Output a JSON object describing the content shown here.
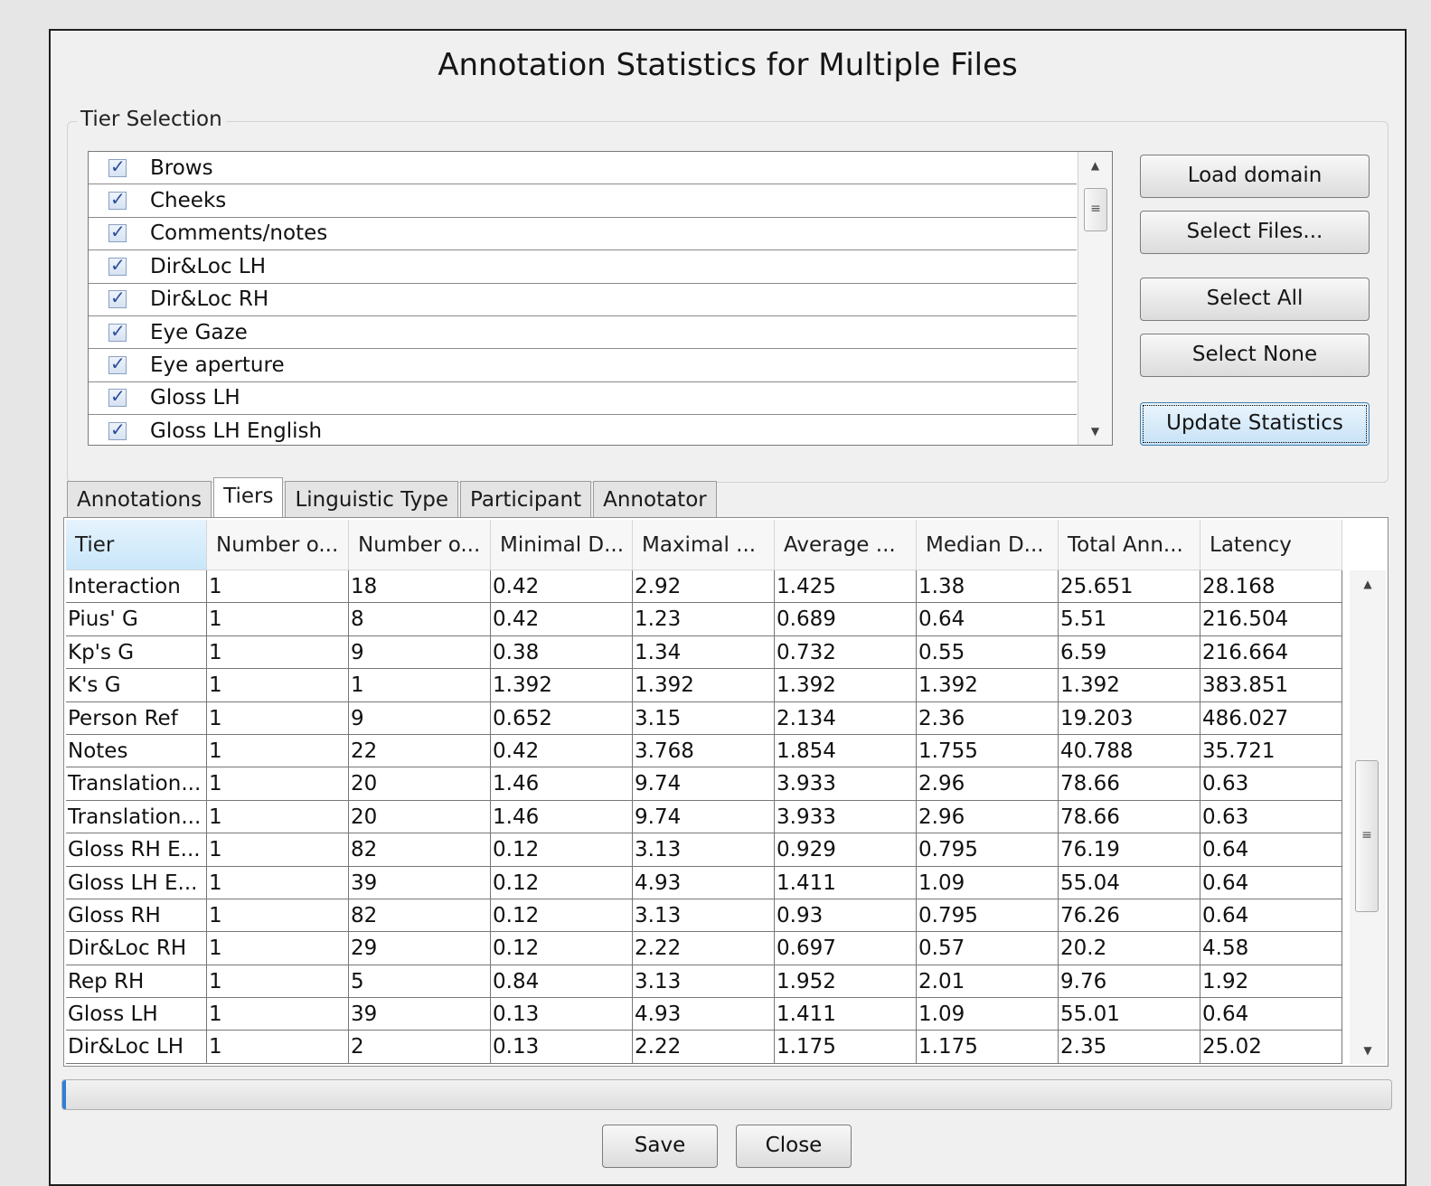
{
  "dialog": {
    "title": "Annotation Statistics for Multiple Files"
  },
  "tier_selection": {
    "label": "Tier Selection",
    "tiers": [
      {
        "name": "Brows",
        "checked": true
      },
      {
        "name": "Cheeks",
        "checked": true
      },
      {
        "name": "Comments/notes",
        "checked": true
      },
      {
        "name": "Dir&Loc LH",
        "checked": true
      },
      {
        "name": "Dir&Loc RH",
        "checked": true
      },
      {
        "name": "Eye Gaze",
        "checked": true
      },
      {
        "name": "Eye aperture",
        "checked": true
      },
      {
        "name": "Gloss LH",
        "checked": true
      },
      {
        "name": "Gloss LH English",
        "checked": true
      }
    ],
    "buttons": {
      "load_domain": "Load domain",
      "select_files": "Select Files...",
      "select_all": "Select All",
      "select_none": "Select None",
      "update_statistics": "Update Statistics"
    }
  },
  "tabs": [
    "Annotations",
    "Tiers",
    "Linguistic Type",
    "Participant",
    "Annotator"
  ],
  "active_tab": "Tiers",
  "table": {
    "columns": [
      "Tier",
      "Number o...",
      "Number o...",
      "Minimal D...",
      "Maximal ...",
      "Average ...",
      "Median D...",
      "Total Ann...",
      "Latency"
    ],
    "rows": [
      [
        "Interaction",
        "1",
        "18",
        "0.42",
        "2.92",
        "1.425",
        "1.38",
        "25.651",
        "28.168"
      ],
      [
        "Pius' G",
        "1",
        "8",
        "0.42",
        "1.23",
        "0.689",
        "0.64",
        "5.51",
        "216.504"
      ],
      [
        "Kp's G",
        "1",
        "9",
        "0.38",
        "1.34",
        "0.732",
        "0.55",
        "6.59",
        "216.664"
      ],
      [
        "K's G",
        "1",
        "1",
        "1.392",
        "1.392",
        "1.392",
        "1.392",
        "1.392",
        "383.851"
      ],
      [
        "Person Ref",
        "1",
        "9",
        "0.652",
        "3.15",
        "2.134",
        "2.36",
        "19.203",
        "486.027"
      ],
      [
        "Notes",
        "1",
        "22",
        "0.42",
        "3.768",
        "1.854",
        "1.755",
        "40.788",
        "35.721"
      ],
      [
        "Translation...",
        "1",
        "20",
        "1.46",
        "9.74",
        "3.933",
        "2.96",
        "78.66",
        "0.63"
      ],
      [
        "Translation...",
        "1",
        "20",
        "1.46",
        "9.74",
        "3.933",
        "2.96",
        "78.66",
        "0.63"
      ],
      [
        "Gloss RH E...",
        "1",
        "82",
        "0.12",
        "3.13",
        "0.929",
        "0.795",
        "76.19",
        "0.64"
      ],
      [
        "Gloss LH E...",
        "1",
        "39",
        "0.12",
        "4.93",
        "1.411",
        "1.09",
        "55.04",
        "0.64"
      ],
      [
        "Gloss RH",
        "1",
        "82",
        "0.12",
        "3.13",
        "0.93",
        "0.795",
        "76.26",
        "0.64"
      ],
      [
        "Dir&Loc RH",
        "1",
        "29",
        "0.12",
        "2.22",
        "0.697",
        "0.57",
        "20.2",
        "4.58"
      ],
      [
        "Rep RH",
        "1",
        "5",
        "0.84",
        "3.13",
        "1.952",
        "2.01",
        "9.76",
        "1.92"
      ],
      [
        "Gloss LH",
        "1",
        "39",
        "0.13",
        "4.93",
        "1.411",
        "1.09",
        "55.01",
        "0.64"
      ],
      [
        "Dir&Loc LH",
        "1",
        "2",
        "0.13",
        "2.22",
        "1.175",
        "1.175",
        "2.35",
        "25.02"
      ]
    ]
  },
  "footer": {
    "save": "Save",
    "close": "Close"
  },
  "colors": {
    "accent": "#2f7ed8",
    "header_selected": "#c8e6fa",
    "dialog_bg": "#f0f0f0"
  }
}
